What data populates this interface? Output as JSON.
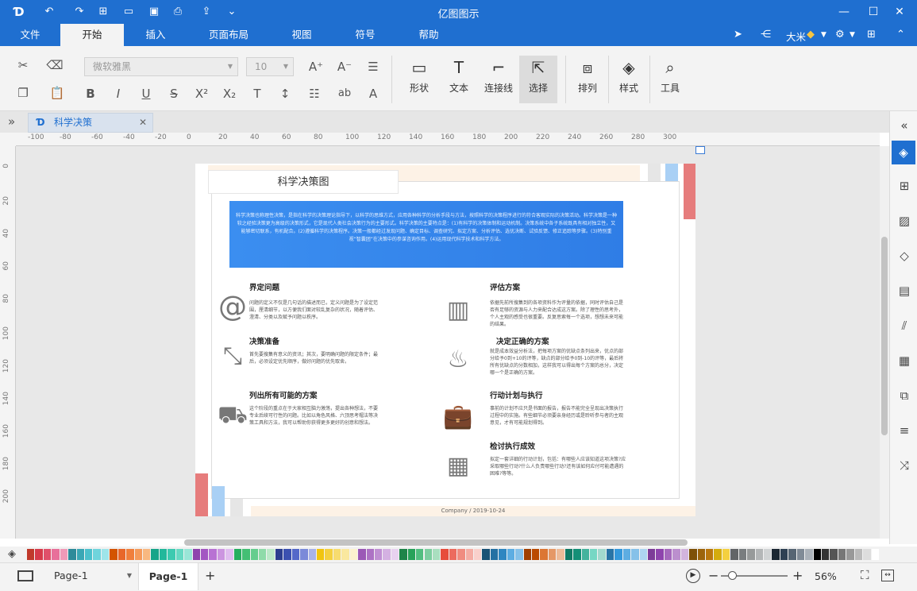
{
  "app": {
    "title": "亿图图示"
  },
  "menu": {
    "items": [
      "文件",
      "开始",
      "插入",
      "页面布局",
      "视图",
      "符号",
      "帮助"
    ],
    "active": "开始"
  },
  "user": {
    "name": "大米"
  },
  "ribbon": {
    "font_name": "微软雅黑",
    "font_size": "10",
    "shape_label": "形状",
    "text_label": "文本",
    "connector_label": "连接线",
    "select_label": "选择",
    "arrange_label": "排列",
    "style_label": "样式",
    "tools_label": "工具"
  },
  "doc_tab": {
    "name": "科学决策"
  },
  "ruler": {
    "h_ticks": [
      "-100",
      "-80",
      "-60",
      "-40",
      "-20",
      "0",
      "20",
      "40",
      "60",
      "80",
      "100",
      "120",
      "140",
      "160",
      "180",
      "200",
      "220",
      "240",
      "260",
      "280",
      "300"
    ],
    "v_ticks": [
      "0",
      "20",
      "40",
      "60",
      "80",
      "100",
      "120",
      "140",
      "160",
      "180",
      "200"
    ]
  },
  "diagram": {
    "title": "科学决策图",
    "intro": "科学决策也称理性决策，是指在科学的决策理论指导下，以科学的思维方式，应用各种科学的分析手段与方法，按照科学的决策程序进行的符合客观实际的决策活动。科学决策是一种较之经验决策更为高级的决策形式，它是现代人类社会决策行为的主要形式。科学决策的主要特点是：(1)有科学的决策体制和运动机制。决策系统中各子系统既具有相对独立性，又能够密切联系，有机配合。(2)遵循科学的决策程序。决策一般都经过发现问题、确定目标、调查研究、拟定方案、分析评估、选优决断、试验反馈、修正追踪等步骤。(3)特别重视“智囊团”在决策中的参谋咨询作用。(4)运用现代科学技术和科学方法。",
    "sections": [
      {
        "title": "界定问题",
        "icon": "at-icon",
        "text": "问题的定义不仅是几句话的描述而已，定义问题是为了设定范围，厘清细节，以方便我们面对较乱复杂的状况，随着评估、澄清、分类以及赋予问题以秩序。"
      },
      {
        "title": "决策准备",
        "icon": "compress-arrows-icon",
        "text": "首先要搜集有意义的资讯；其次，要明确问题的限定条件；最后，必须设定优先顺序，做好问题的优先取舍。"
      },
      {
        "title": "列出所有可能的方案",
        "icon": "shopping-bag-icon",
        "text": "这个阶段的重点在于大家相互脑力激荡，提出各种想法，不要专业后续可行性的问题。比如以角色风格、六顶思考帽法等决策工具和方法，我可以帮助你获得更多更好的创意和想法。"
      },
      {
        "title": "评估方案",
        "icon": "bar-chart-icon",
        "text": "依据先前所搜集到的各项资料作为评量的依据，同时评估自己是否有足够的资源与人力来配合达成这方案。除了理性的思考外，个人主观的感受也很重要。反复思索每一个选项，想想未来可能的结果。"
      },
      {
        "title": "决定正确的方案",
        "icon": "cake-icon",
        "text": "就是成本效益分析法，把每项方案的优缺点条列出来，优点的部分给予0到+10的评等，缺点的部分给予0到-10的评等，最后将所有优缺点的分数相加，这样我可以得出每个方案的总分，决定哪一个是正确的方案。"
      },
      {
        "title": "行动计划与执行",
        "icon": "briefcase-icon",
        "text": "事前的计划不应只是书面的报告，报告不能完全呈现出决策执行过程中的实施。有些细节必须要亲身经历或是聆听参与者的主观意见，才有可能规划得到。"
      },
      {
        "title": "检讨执行成效",
        "icon": "calendar-icon",
        "text": "拟定一套详细的行动计划，包括：有哪些人应该知道这项决策?应采取哪些行动?什么人负责哪些行动?还有该如何应付可能遭遇的困难?等等。"
      }
    ],
    "footer": "Company / 2019-10-24"
  },
  "status": {
    "page_select": "Page-1",
    "page_tab": "Page-1",
    "zoom": "56%",
    "zoom_level": 0.56
  },
  "palette_colors": [
    "#c0392b",
    "#d63a4a",
    "#e0506a",
    "#e8709a",
    "#f09ab8",
    "#2e8b9a",
    "#3aa7b5",
    "#4cc0cc",
    "#6fd4dc",
    "#9ee5ea",
    "#d35400",
    "#e8672a",
    "#f07f3c",
    "#f59a5a",
    "#f8b880",
    "#17a589",
    "#22b89b",
    "#3ccab0",
    "#66d9c3",
    "#99e6d7",
    "#8e44ad",
    "#a356c2",
    "#b872d3",
    "#cc95e0",
    "#e0bdef",
    "#27ae60",
    "#43bf74",
    "#65cd8e",
    "#8fdba9",
    "#bde9c9",
    "#2c3e8f",
    "#3b50b0",
    "#5468c9",
    "#7b8ad9",
    "#a9b3e8",
    "#f1c40f",
    "#f4d03f",
    "#f7dc6f",
    "#fae89f",
    "#fcf3cf",
    "#9b59b6",
    "#ad72c4",
    "#c090d3",
    "#d4b1e2",
    "#e8d2f0",
    "#1e8449",
    "#28a25a",
    "#52be80",
    "#7dcea0",
    "#a9dfbf",
    "#e74c3c",
    "#ec6b5e",
    "#f08c80",
    "#f4ada4",
    "#f9d0cb",
    "#1a5276",
    "#2471a3",
    "#2e86c1",
    "#5dade2",
    "#85c1e9",
    "#a04000",
    "#ba4a00",
    "#dc7633",
    "#e59866",
    "#edbb99",
    "#117a65",
    "#148f77",
    "#45b39d",
    "#76d7c4",
    "#a2d9ce",
    "#2874a6",
    "#3498db",
    "#5dade2",
    "#85c1e9",
    "#aed6f1",
    "#7d3c98",
    "#8e44ad",
    "#a569bd",
    "#bb8fce",
    "#d2b4de",
    "#7e5109",
    "#9c640c",
    "#b9770e",
    "#d4ac0d",
    "#f4d03f",
    "#626567",
    "#797d7f",
    "#979a9a",
    "#b3b6b7",
    "#d0d3d4",
    "#1c2833",
    "#2e4053",
    "#566573",
    "#808b96",
    "#abb2b9",
    "#000000",
    "#333333",
    "#555555",
    "#777777",
    "#999999",
    "#bbbbbb",
    "#dddddd",
    "#ffffff"
  ]
}
